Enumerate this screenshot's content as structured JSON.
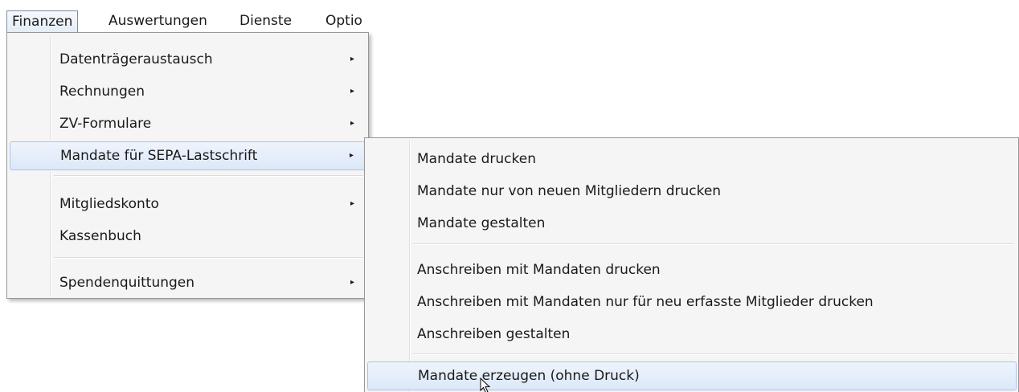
{
  "menubar": {
    "items": [
      {
        "label": "Finanzen",
        "active": true
      },
      {
        "label": "Auswertungen"
      },
      {
        "label": "Dienste"
      },
      {
        "label": "Optio"
      }
    ]
  },
  "finanzen_menu": {
    "items": [
      {
        "label": "Datenträgeraustausch",
        "has_submenu": true
      },
      {
        "label": "Rechnungen",
        "has_submenu": true
      },
      {
        "label": "ZV-Formulare",
        "has_submenu": true
      },
      {
        "label": "Mandate für SEPA-Lastschrift",
        "has_submenu": true,
        "highlighted": true
      },
      {
        "label": "Mitgliedskonto",
        "has_submenu": true
      },
      {
        "label": "Kassenbuch"
      },
      {
        "label": "Spendenquittungen",
        "has_submenu": true
      }
    ],
    "arrow_glyph": "▸"
  },
  "sepa_submenu": {
    "items": [
      {
        "label": "Mandate drucken"
      },
      {
        "label": "Mandate nur von neuen Mitgliedern drucken"
      },
      {
        "label": "Mandate gestalten"
      },
      {
        "label": "Anschreiben mit Mandaten drucken"
      },
      {
        "label": "Anschreiben mit Mandaten nur für neu erfasste Mitglieder drucken"
      },
      {
        "label": "Anschreiben gestalten"
      },
      {
        "label": "Mandate erzeugen (ohne Druck)",
        "highlighted": true
      }
    ]
  },
  "colors": {
    "menu_bg": "#f5f5f5",
    "hover_border": "#a8c4e8",
    "hover_bg": "#dce8f8"
  }
}
